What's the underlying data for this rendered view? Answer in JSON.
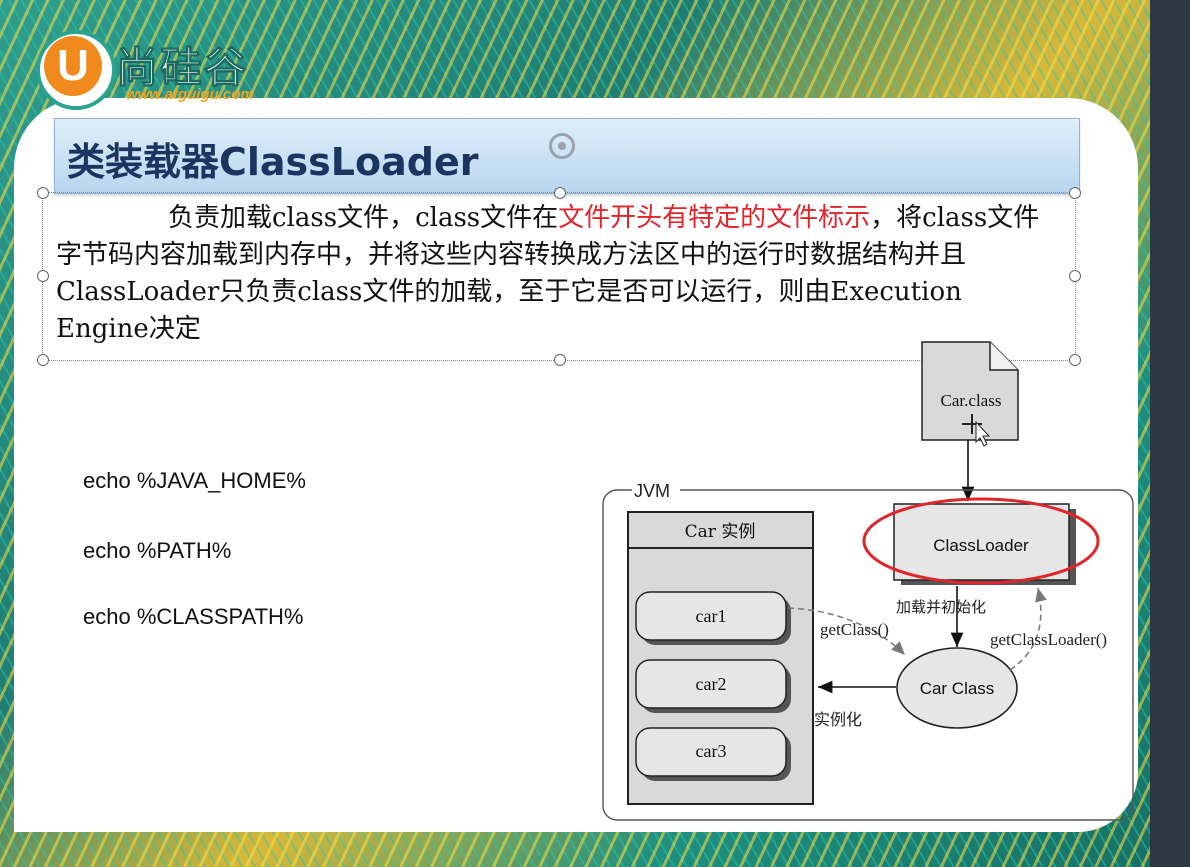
{
  "logo": {
    "cn": "尚硅谷",
    "url": "www.atguigu.com",
    "letter": "U"
  },
  "title": "类装载器ClassLoader",
  "paragraph": {
    "part1": "负责加载class文件，class文件在",
    "highlight": "文件开头有特定的文件标示",
    "part2": "，将class文件字节码内容加载到内存中，并将这些内容转换成方法区中的运行时数据结构并且ClassLoader只负责class文件的加载，至于它是否可以运行，则由Execution Engine决定"
  },
  "commands": [
    "echo %JAVA_HOME%",
    "echo %PATH%",
    "echo %CLASSPATH%"
  ],
  "diagram": {
    "file_label": "Car.class",
    "jvm_label": "JVM",
    "instance_header": "Car 实例",
    "instances": [
      "car1",
      "car2",
      "car3"
    ],
    "classloader_label": "ClassLoader",
    "class_label": "Car Class",
    "load_label": "加载并初始化",
    "getclass_label": "getClass()",
    "getclassloader_label": "getClassLoader()",
    "instantiate_label": "实例化"
  },
  "colors": {
    "highlight": "#e0252b",
    "title": "#1a3660",
    "ellipse": "#e0252b"
  }
}
